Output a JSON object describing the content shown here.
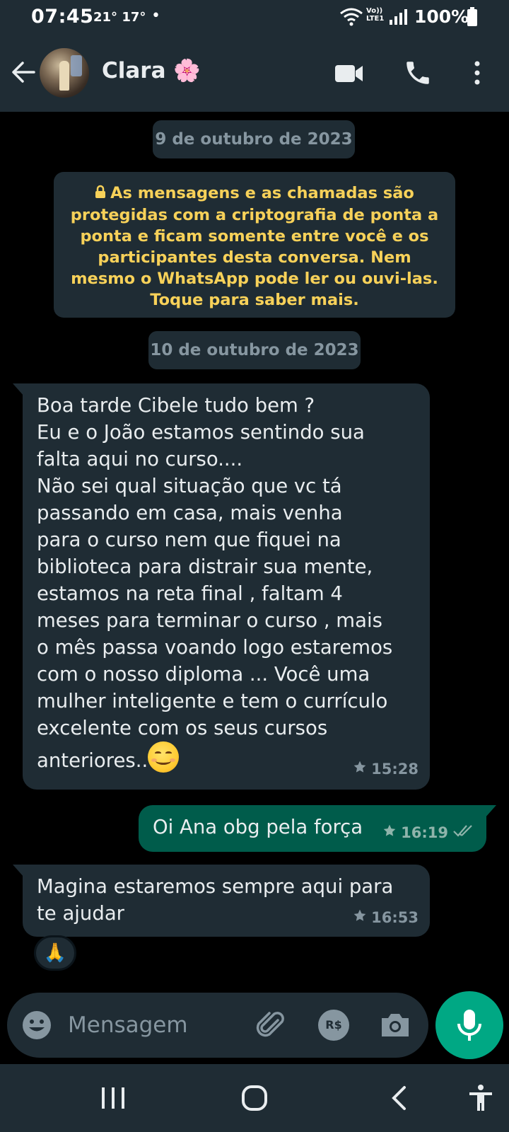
{
  "status_bar": {
    "time": "07:45",
    "weather": "21° 17°",
    "dot": "•",
    "network_top": "Vo))",
    "network_bottom": "LTE1",
    "battery": "100%"
  },
  "header": {
    "contact_name": "Clara 🌸",
    "icons": [
      "back-arrow-icon",
      "video-camera-icon",
      "phone-icon",
      "more-vert-icon"
    ]
  },
  "chat": {
    "date_1": "9 de outubro de 2023",
    "encryption_notice": "As mensagens e as chamadas são protegidas com a criptografia de ponta a ponta e ficam somente entre você e os participantes desta conversa. Nem mesmo o WhatsApp pode ler ou ouvi-las. Toque para saber mais.",
    "date_2": "10 de outubro de 2023",
    "messages": [
      {
        "direction": "incoming",
        "text": "Boa tarde Cibele tudo bem ?\nEu e o João estamos sentindo sua\nfalta aqui no curso....\nNão sei qual situação que vc tá\npassando em casa, mais venha\npara o curso nem que fiquei na\nbiblioteca para distrair sua mente,\nestamos na reta final , faltam 4\nmeses para terminar o curso , mais\no mês passa voando logo estaremos\ncom o nosso diploma ... Você uma\nmulher inteligente e tem o currículo\nexcelente com os seus cursos\nanteriores..",
        "emoji": "smiling-face-emoji",
        "time": "15:28",
        "starred": true
      },
      {
        "direction": "outgoing",
        "text": "Oi Ana obg pela força",
        "time": "16:19",
        "starred": true,
        "status": "read"
      },
      {
        "direction": "incoming",
        "text": "Magina estaremos sempre aqui para\nte ajudar",
        "time": "16:53",
        "starred": true,
        "reaction": "🙏"
      }
    ]
  },
  "composer": {
    "placeholder": "Mensagem",
    "pay_label": "R$"
  },
  "colors": {
    "bar_bg": "#1f2c34",
    "chat_bg": "#000000",
    "incoming_bubble": "#1f2c34",
    "outgoing_bubble": "#005c4b",
    "notice_text": "#f7d159",
    "accent": "#00a884",
    "meta_text": "#8696a0"
  }
}
